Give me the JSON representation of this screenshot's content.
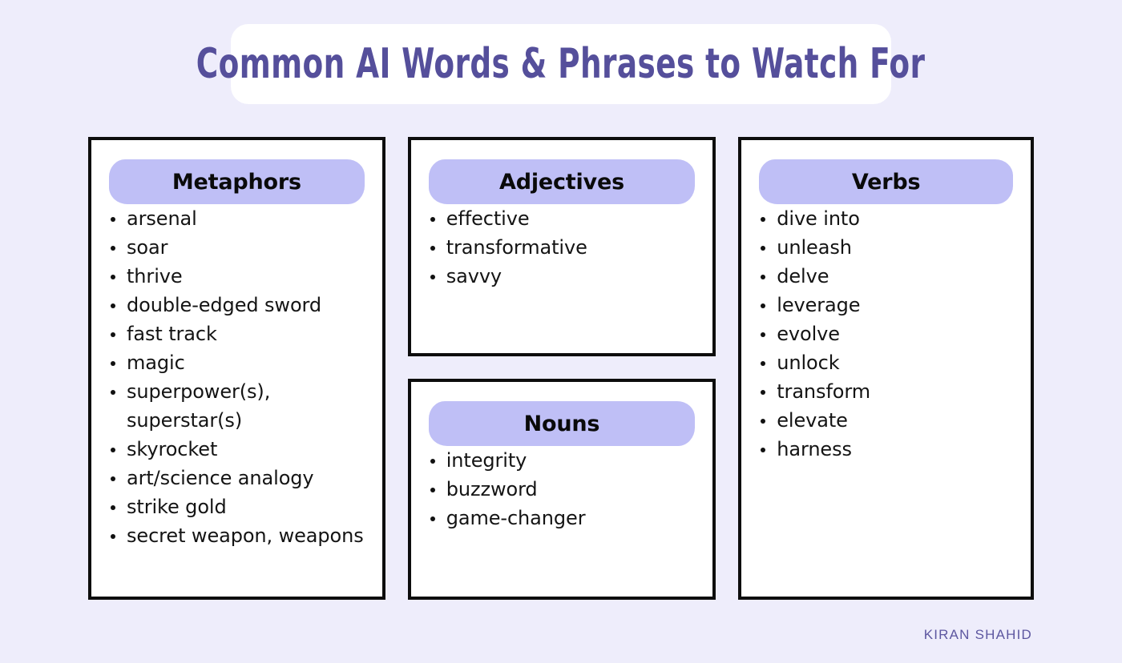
{
  "page": {
    "background_color": "#eeedfb",
    "title": "Common AI Words & Phrases to Watch For",
    "title_color": "#554f9b",
    "pill_color": "#bfbff6",
    "card_border_color": "#0d0d0d",
    "credit": "KIRAN SHAHID",
    "credit_color": "#5d57a0"
  },
  "cards": [
    {
      "id": "metaphors",
      "heading": "Metaphors",
      "items": [
        "arsenal",
        "soar",
        "thrive",
        "double-edged sword",
        "fast track",
        "magic",
        "superpower(s), superstar(s)",
        "skyrocket",
        "art/science analogy",
        "strike gold",
        "secret weapon, weapons"
      ]
    },
    {
      "id": "adjectives",
      "heading": "Adjectives",
      "items": [
        "effective",
        "transformative",
        "savvy"
      ]
    },
    {
      "id": "nouns",
      "heading": "Nouns",
      "items": [
        "integrity",
        "buzzword",
        "game-changer"
      ]
    },
    {
      "id": "verbs",
      "heading": "Verbs",
      "items": [
        "dive into",
        "unleash",
        "delve",
        "leverage",
        "evolve",
        "unlock",
        "transform",
        "elevate",
        "harness"
      ]
    }
  ]
}
